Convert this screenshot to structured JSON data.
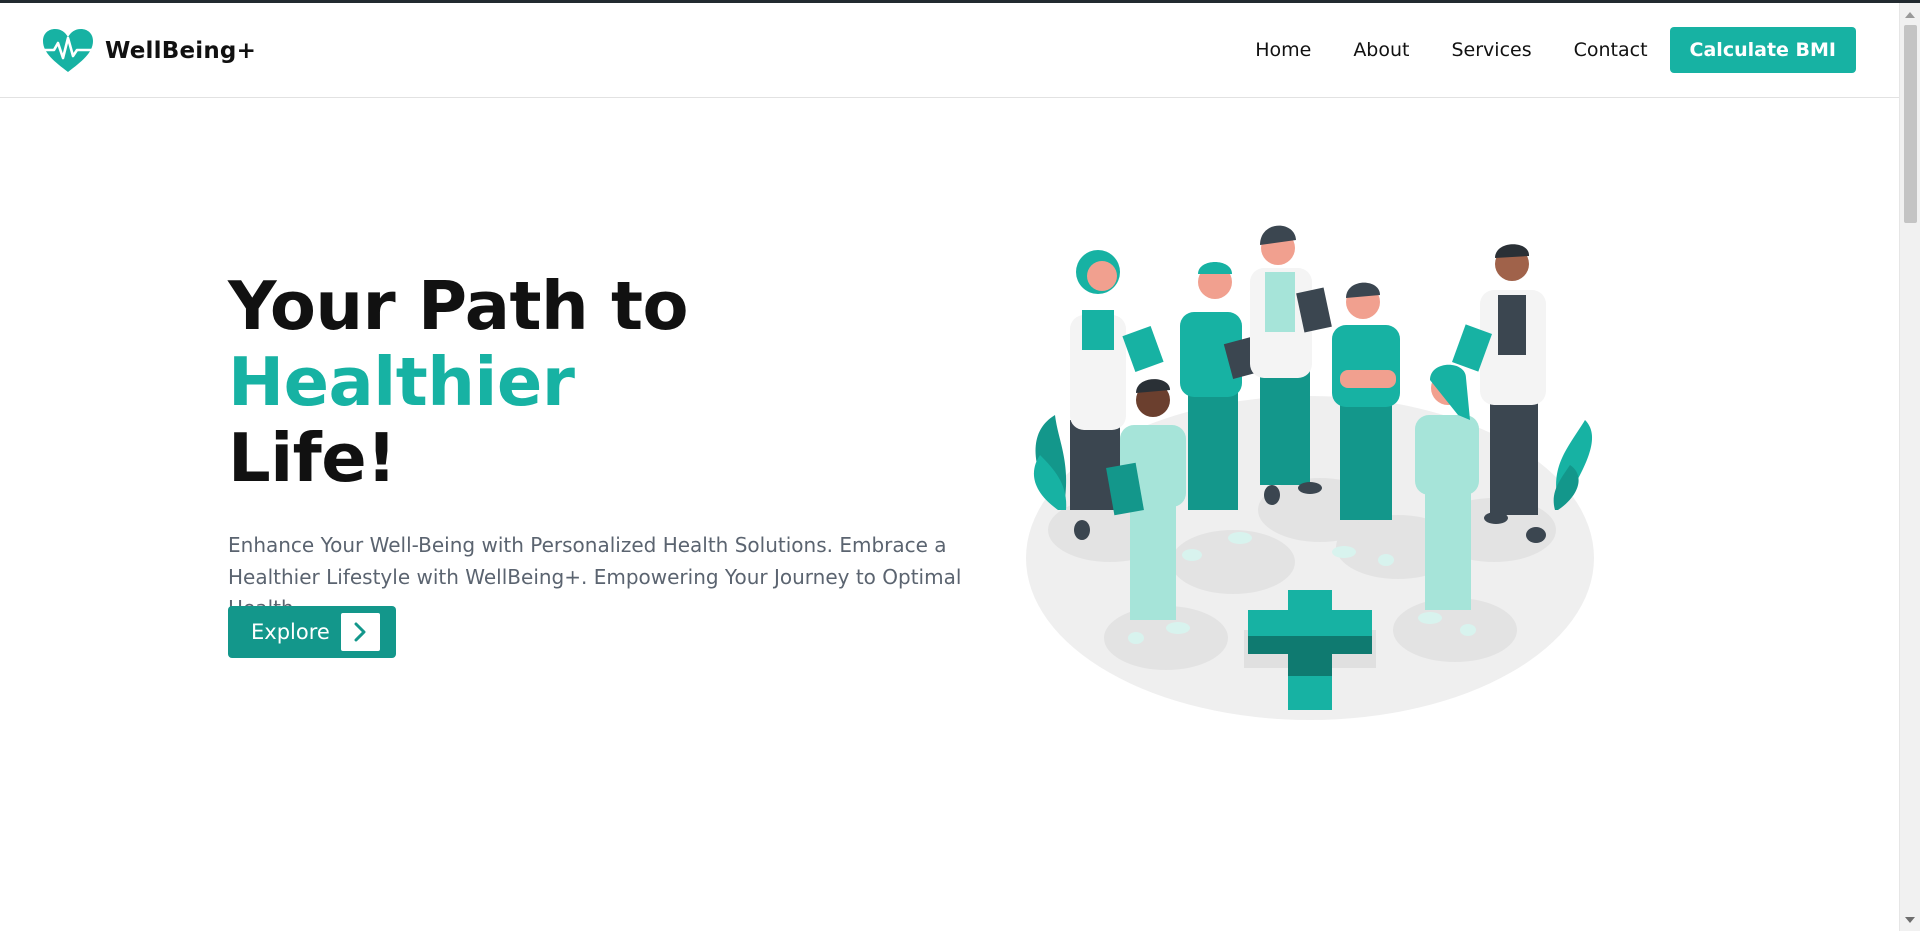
{
  "brand": {
    "name": "WellBeing+",
    "logo_icon": "heart-pulse-icon",
    "accent_color": "#17b2a3"
  },
  "nav": {
    "links": [
      "Home",
      "About",
      "Services",
      "Contact"
    ],
    "cta_label": "Calculate BMI"
  },
  "hero": {
    "title_part1": "Your Path to",
    "title_accent": "Healthier",
    "title_part2": "Life!",
    "subtitle": "Enhance Your Well-Being with Personalized Health Solutions. Embrace a Healthier Lifestyle with WellBeing+. Empowering Your Journey to Optimal Health",
    "cta_label": "Explore",
    "cta_icon": "chevron-right-icon",
    "illustration": "medical-team-illustration"
  },
  "colors": {
    "primary": "#17b2a3",
    "primary_dark": "#13978b",
    "text": "#111111",
    "muted": "#5b6470"
  }
}
